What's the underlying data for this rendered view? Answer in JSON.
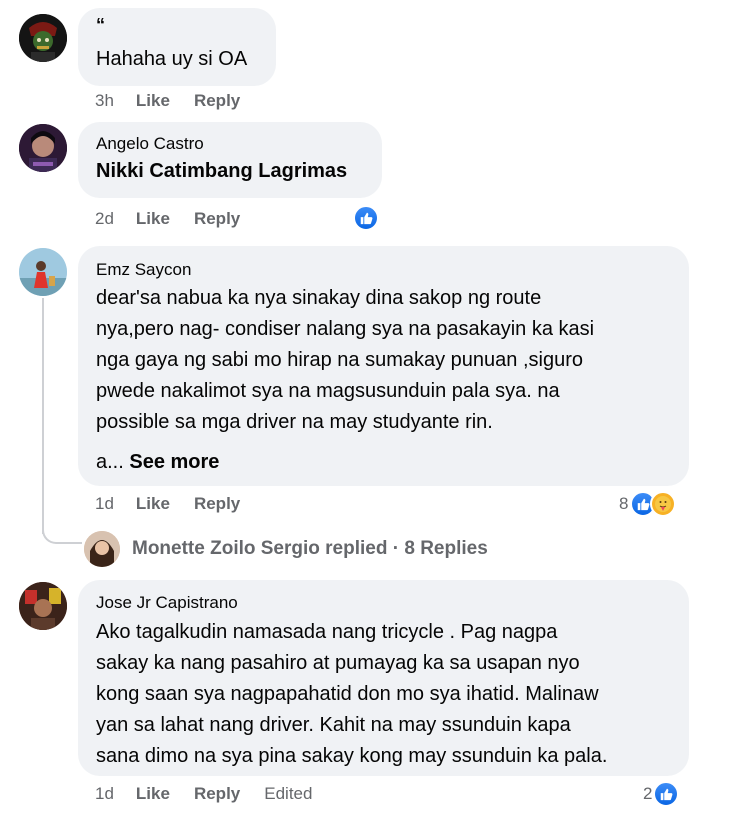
{
  "comments": [
    {
      "author": "“",
      "text": "Hahaha uy si OA",
      "time": "3h",
      "like": "Like",
      "reply": "Reply"
    },
    {
      "author": "Angelo Castro",
      "text": "Nikki Catimbang Lagrimas",
      "time": "2d",
      "like": "Like",
      "reply": "Reply"
    },
    {
      "author": "Emz Saycon",
      "lines": [
        "dear'sa nabua ka nya sinakay dina sakop ng route",
        "nya,pero nag- condiser nalang sya na pasakayin ka kasi",
        "nga gaya ng sabi mo hirap na sumakay punuan ,siguro",
        "pwede nakalimot sya na magsusunduin pala sya. na",
        "possible sa mga driver na may studyante rin."
      ],
      "see_more_prefix": "a...",
      "see_more": "See more",
      "time": "1d",
      "like": "Like",
      "reply": "Reply",
      "reaction_count": "8",
      "replies_summary": "Monette Zoilo Sergio replied · 8 Replies"
    },
    {
      "author": "Jose Jr Capistrano",
      "lines": [
        "Ako tagalkudin namasada nang tricycle . Pag nagpa",
        "sakay ka nang pasahiro at pumayag ka sa usapan nyo",
        "kong saan sya nagpapahatid don mo sya ihatid. Malinaw",
        "yan sa lahat nang driver. Kahit na may ssunduin kapa",
        "sana dimo na sya pina sakay kong may ssunduin ka pala."
      ],
      "time": "1d",
      "like": "Like",
      "reply": "Reply",
      "edited": "Edited",
      "reaction_count": "2"
    }
  ],
  "colors": {
    "bubble": "#f0f2f5",
    "muted": "#65676b",
    "like_blue": "#0a66e4",
    "care_yellow": "#f7b125"
  }
}
